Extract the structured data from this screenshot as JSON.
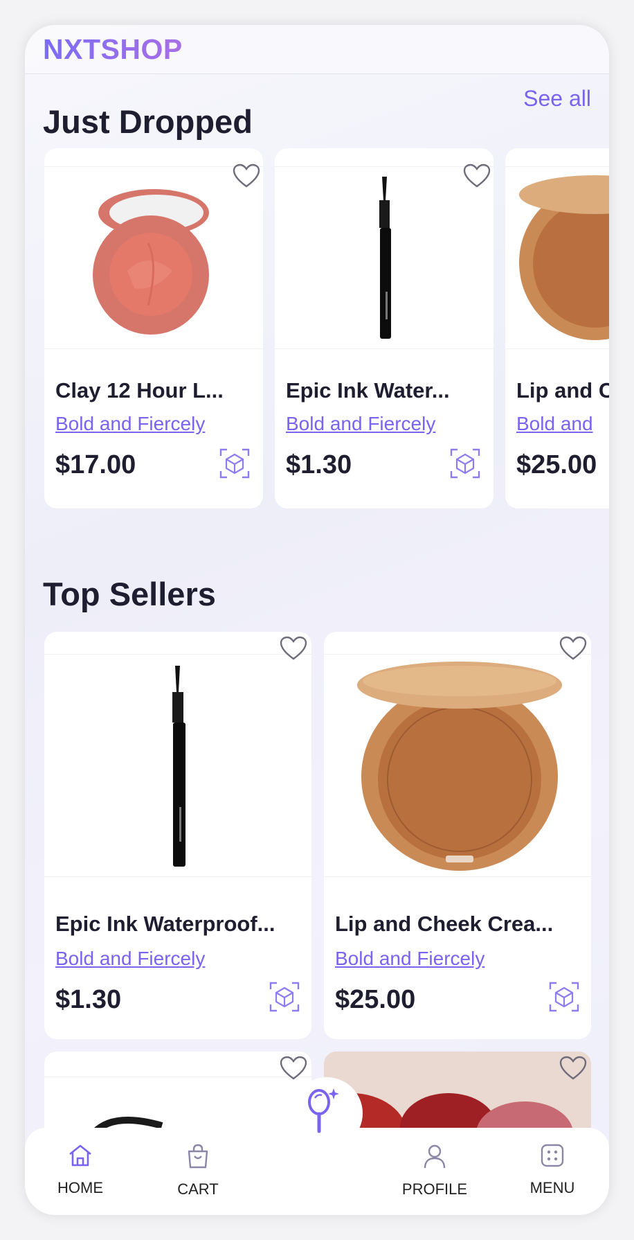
{
  "app": {
    "logo": "NXTSHOP"
  },
  "just_dropped": {
    "title": "Just Dropped",
    "see_all": "See all",
    "items": [
      {
        "name": "Clay 12 Hour L...",
        "brand": "Bold and Fiercely",
        "price": "$17.00",
        "image": "blush-compact"
      },
      {
        "name": "Epic Ink Water...",
        "brand": "Bold and Fiercely",
        "price": "$1.30",
        "image": "eyeliner-pen"
      },
      {
        "name": "Lip and C",
        "brand": "Bold and",
        "price": "$25.00",
        "image": "bronzer-compact"
      }
    ]
  },
  "top_sellers": {
    "title": "Top Sellers",
    "items": [
      {
        "name": "Epic Ink Waterproof...",
        "brand": "Bold and Fiercely",
        "price": "$1.30",
        "image": "eyeliner-pen"
      },
      {
        "name": "Lip and Cheek Crea...",
        "brand": "Bold and Fiercely",
        "price": "$25.00",
        "image": "bronzer-compact"
      }
    ]
  },
  "bottom_nav": {
    "home": "HOME",
    "cart": "CART",
    "profile": "PROFILE",
    "menu": "MENU"
  },
  "icons": {
    "heart": "heart-icon",
    "ar": "ar-cube-icon",
    "mirror": "magic-mirror-icon"
  },
  "colors": {
    "accent": "#7a63ee",
    "text": "#1e1e30"
  }
}
